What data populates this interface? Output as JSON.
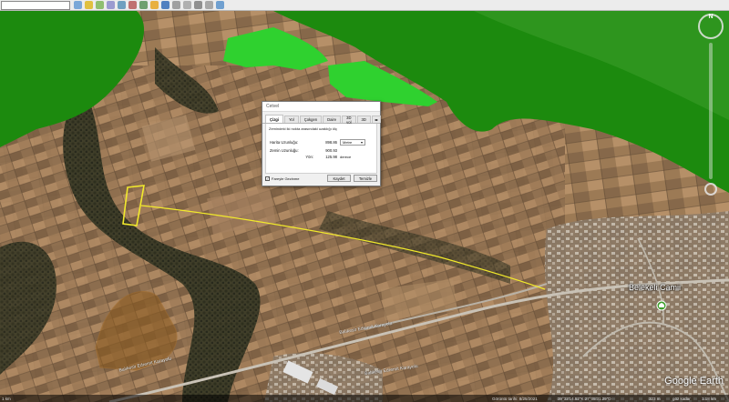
{
  "dialog": {
    "title": "Cetvel",
    "tabs": [
      "Çizgi",
      "Yol",
      "Çokgen",
      "Daire",
      "3D yol",
      "3D"
    ],
    "description": "Zemindeki iki nokta arasındaki uzaklığı ölç",
    "map_length_label": "Harita Uzunluğu:",
    "map_length_value": "898.86",
    "map_length_unit": "Metre",
    "ground_length_label": "Zemin Uzunluğu:",
    "ground_length_value": "900.93",
    "heading_label": "Yön:",
    "heading_value": "125.98",
    "heading_unit": "derece",
    "checkbox_label": "Fareyle Gezinme",
    "save_button": "Kaydet",
    "clear_button": "Temizle"
  },
  "map": {
    "place_label": "Belekeli Camii",
    "road_labels": [
      "Balıkesir Edremit Karayolu",
      "Balıkesir Edremit Karayolu",
      "Balıkesir Edremit Karayolu"
    ],
    "logo": "Google Earth"
  },
  "status_bar": {
    "scale": "1 km",
    "imagery_date": "Görüntü tarihi: 8/25/2021",
    "coordinates": "39°32'14.52\"K  27°05'31.29\"D",
    "elevation": "323 m",
    "eye_alt": "göz kadar",
    "eye_alt_value": "1.18 km"
  },
  "colors": {
    "overlay_green": "#2fd12f",
    "forest_green": "#1c8a0e",
    "measure_line": "#f2ea2c",
    "polygon_orange": "#8a5a20"
  }
}
